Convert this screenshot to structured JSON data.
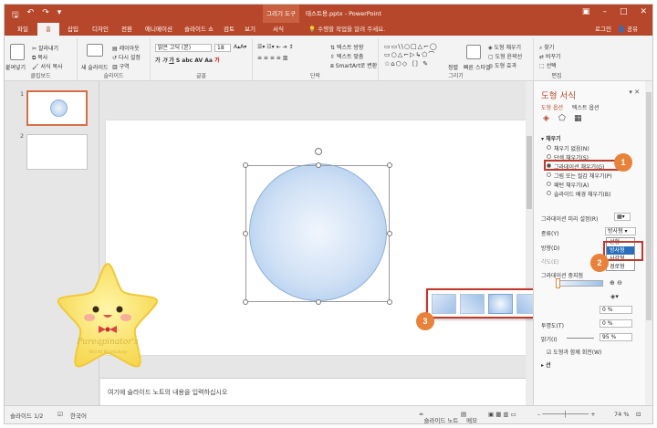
{
  "window": {
    "context_tab": "그리기 도구",
    "doc_title": "테스트용.pptx - PowerPoint",
    "login": "로그인",
    "share": "공유"
  },
  "tabs": [
    {
      "label": "파일",
      "active": false
    },
    {
      "label": "홈",
      "active": true
    },
    {
      "label": "삽입",
      "active": false
    },
    {
      "label": "디자인",
      "active": false
    },
    {
      "label": "전환",
      "active": false
    },
    {
      "label": "애니메이션",
      "active": false
    },
    {
      "label": "슬라이드 쇼",
      "active": false
    },
    {
      "label": "검토",
      "active": false
    },
    {
      "label": "보기",
      "active": false
    },
    {
      "label": "서식",
      "active": false
    }
  ],
  "tell_me": "수행할 작업을 알려 주세요.",
  "ribbon": {
    "clipboard": {
      "paste": "붙여넣기",
      "cut": "잘라내기",
      "copy": "복사",
      "format_copy": "서식 복사",
      "label": "클립보드"
    },
    "slides": {
      "new": "새 슬라이드",
      "layout": "레이아웃",
      "reset": "다시 설정",
      "section": "구역",
      "label": "슬라이드"
    },
    "font": {
      "name": "맑은 고딕 (본)",
      "size": "18",
      "label": "글꼴"
    },
    "paragraph": {
      "direction": "텍스트 방향",
      "align": "텍스트 맞춤",
      "smartart": "SmartArt로 변환",
      "label": "단락"
    },
    "drawing": {
      "arrange": "정렬",
      "quick_styles": "빠른 스타일",
      "fill": "도형 채우기",
      "outline": "도형 윤곽선",
      "effects": "도형 효과",
      "label": "그리기"
    },
    "editing": {
      "find": "찾기",
      "replace": "바꾸기",
      "select": "선택",
      "label": "편집"
    }
  },
  "thumbnails": [
    {
      "num": "1"
    },
    {
      "num": "2"
    }
  ],
  "notes_placeholder": "여기에 슬라이드 노트의 내용을 입력하십시오",
  "mascot_text": "Pureqpinator's World Workshop",
  "pane": {
    "title": "도형 서식",
    "tab_shape": "도형 옵션",
    "tab_text": "텍스트 옵션",
    "section_fill": "채우기",
    "options": [
      {
        "label": "채우기 없음(N)",
        "checked": false
      },
      {
        "label": "단색 채우기(S)",
        "checked": false
      },
      {
        "label": "그라데이션 채우기(G)",
        "checked": true
      },
      {
        "label": "그림 또는 질감 채우기(P)",
        "checked": false
      },
      {
        "label": "패턴 채우기(A)",
        "checked": false
      },
      {
        "label": "슬라이드 배경 채우기(B)",
        "checked": false
      }
    ],
    "preset_label": "그라데이션 미리 설정(R)",
    "type_label": "종류(Y)",
    "type_value": "방사형",
    "type_options": [
      "선형",
      "방사형",
      "사각형",
      "경로형"
    ],
    "type_selected": 1,
    "direction_label": "방향(D)",
    "angle_label": "각도(E)",
    "stops_label": "그라데이션 중지점",
    "position_value": "0 %",
    "transparency_label": "투명도(T)",
    "transparency_value": "0 %",
    "brightness_label": "밝기(I)",
    "brightness_value": "95 %",
    "rotate_with_shape": "도형과 함께 회전(W)",
    "section_line": "선"
  },
  "callouts": [
    "1",
    "2",
    "3"
  ],
  "status": {
    "slide": "슬라이드 1/2",
    "lang": "한국어",
    "notes": "슬라이드 노트",
    "comments": "메모",
    "zoom": "74 %"
  },
  "colors": {
    "accent": "#b7472a",
    "callout": "#e8823a",
    "highlight": "#c0392b"
  }
}
